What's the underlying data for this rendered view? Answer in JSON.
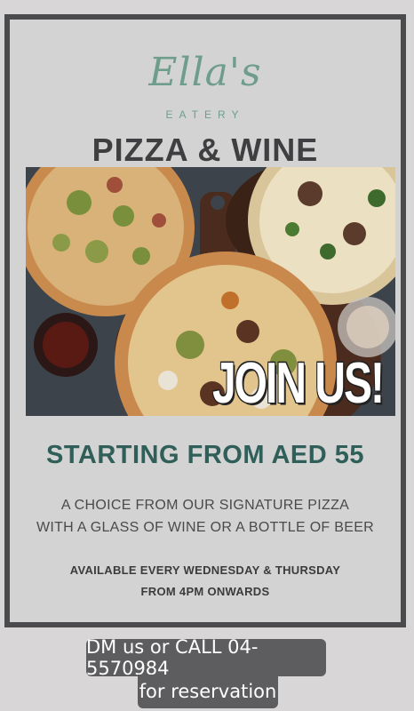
{
  "brand": {
    "name": "Ella's",
    "subtitle": "EATERY"
  },
  "headline": "PIZZA & WINE",
  "photo": {
    "overlay_text": "JOIN US!"
  },
  "offer": {
    "price_line": "STARTING FROM AED 55"
  },
  "description": {
    "line1": "A CHOICE FROM OUR SIGNATURE PIZZA",
    "line2": "WITH A GLASS OF WINE OR A BOTTLE OF BEER"
  },
  "availability": {
    "line1": "AVAILABLE EVERY WEDNESDAY & THURSDAY",
    "line2": "FROM 4PM ONWARDS"
  },
  "cta": {
    "line1": "DM us or CALL 04-5570984",
    "line2": "for reservation"
  },
  "colors": {
    "accent": "#6f9d8c",
    "price": "#2f5f58",
    "frame": "#4b4b4d",
    "cta_bg": "#5d5c5e"
  }
}
